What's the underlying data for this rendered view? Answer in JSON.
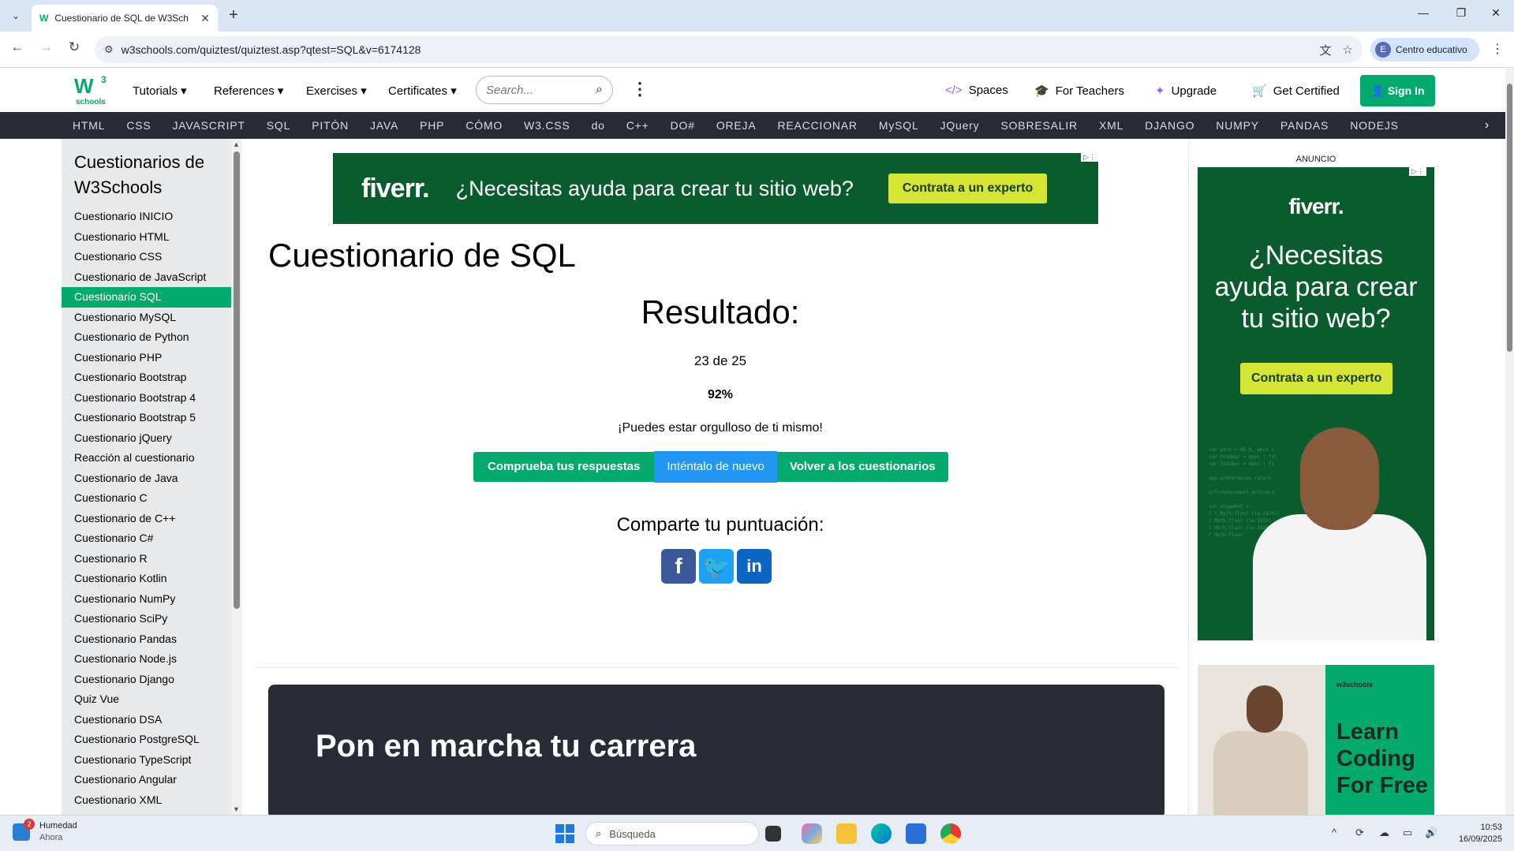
{
  "browser": {
    "tab_title": "Cuestionario de SQL de W3Sch",
    "url": "w3schools.com/quiztest/quiztest.asp?qtest=SQL&v=6174128",
    "profile_initial": "E",
    "profile_label": "Centro educativo"
  },
  "header": {
    "logo_text": "W",
    "logo_sup": "3",
    "logo_sub": "schools",
    "menu": [
      "Tutorials",
      "References",
      "Exercises",
      "Certificates"
    ],
    "search_placeholder": "Search...",
    "right_links": [
      "Spaces",
      "For Teachers",
      "Upgrade",
      "Get Certified"
    ],
    "signin_label": "Sign In"
  },
  "topnav": [
    "HTML",
    "CSS",
    "JAVASCRIPT",
    "SQL",
    "PITÓN",
    "JAVA",
    "PHP",
    "CÓMO",
    "W3.CSS",
    "do",
    "C++",
    "DO#",
    "OREJA",
    "REACCIONAR",
    "MySQL",
    "JQuery",
    "SOBRESALIR",
    "XML",
    "DJANGO",
    "NUMPY",
    "PANDAS",
    "NODEJS"
  ],
  "sidebar": {
    "title": "Cuestionarios de W3Schools",
    "items": [
      "Cuestionario INICIO",
      "Cuestionario HTML",
      "Cuestionario CSS",
      "Cuestionario de JavaScript",
      "Cuestionario SQL",
      "Cuestionario MySQL",
      "Cuestionario de Python",
      "Cuestionario PHP",
      "Cuestionario Bootstrap",
      "Cuestionario Bootstrap 4",
      "Cuestionario Bootstrap 5",
      "Cuestionario jQuery",
      "Reacción al cuestionario",
      "Cuestionario de Java",
      "Cuestionario C",
      "Cuestionario de C++",
      "Cuestionario C#",
      "Cuestionario R",
      "Cuestionario Kotlin",
      "Cuestionario NumPy",
      "Cuestionario SciPy",
      "Cuestionario Pandas",
      "Cuestionario Node.js",
      "Cuestionario Django",
      "Quiz Vue",
      "Cuestionario DSA",
      "Cuestionario PostgreSQL",
      "Cuestionario TypeScript",
      "Cuestionario Angular",
      "Cuestionario XML"
    ],
    "active_index": 4
  },
  "ad_top": {
    "brand": "fiverr.",
    "text": "¿Necesitas ayuda para crear tu sitio web?",
    "cta": "Contrata a un experto"
  },
  "quiz": {
    "title": "Cuestionario de SQL",
    "result_heading": "Resultado:",
    "score": "23 de 25",
    "percent": "92%",
    "message": "¡Puedes estar orgulloso de ti mismo!",
    "buttons": [
      "Comprueba tus respuestas",
      "Inténtalo de nuevo",
      "Volver a los cuestionarios"
    ],
    "share_heading": "Comparte tu puntuación:"
  },
  "career": {
    "title": "Pon en marcha tu carrera"
  },
  "ad_right": {
    "label": "ANUNCIO",
    "brand": "fiverr.",
    "text": "¿Necesitas ayuda para crear tu sitio web?",
    "cta": "Contrata a un experto"
  },
  "ad_learn": {
    "brand": "w3schools",
    "text": "Learn Coding For Free"
  },
  "taskbar": {
    "weather_title": "Humedad",
    "weather_sub": "Ahora",
    "weather_badge": "2",
    "search_placeholder": "Búsqueda",
    "time": "10:53",
    "date": "16/09/2025"
  }
}
